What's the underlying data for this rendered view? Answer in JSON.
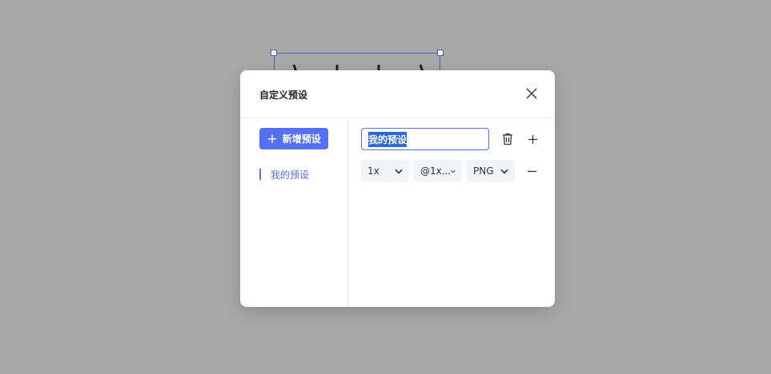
{
  "dialog": {
    "title": "自定义预设",
    "add_preset_label": "新增预设",
    "presets": [
      {
        "label": "我的预设",
        "active": true
      }
    ],
    "editor": {
      "name_value": "我的预设",
      "rows": [
        {
          "scale": "1x",
          "suffix": "@1x...",
          "format": "PNG"
        }
      ]
    }
  },
  "icons": {
    "close": "close-icon",
    "add": "plus-icon",
    "delete": "trash-icon",
    "remove_row": "minus-icon",
    "dropdown": "chevron-down-icon"
  },
  "colors": {
    "backdrop": "#a9a9a9",
    "accent": "#5570f1",
    "text_selection": "#2c67d8",
    "select_bg": "#f3f4f6"
  }
}
